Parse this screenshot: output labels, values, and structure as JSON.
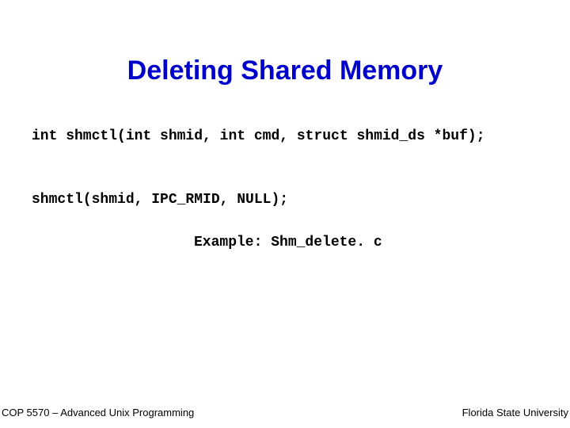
{
  "title": "Deleting Shared Memory",
  "code_signature": "int shmctl(int shmid, int cmd, struct shmid_ds *buf);",
  "code_call": "shmctl(shmid, IPC_RMID, NULL);",
  "example_line": "Example: Shm_delete. c",
  "footer": {
    "left": "COP 5570 – Advanced Unix Programming",
    "right": "Florida State University"
  }
}
